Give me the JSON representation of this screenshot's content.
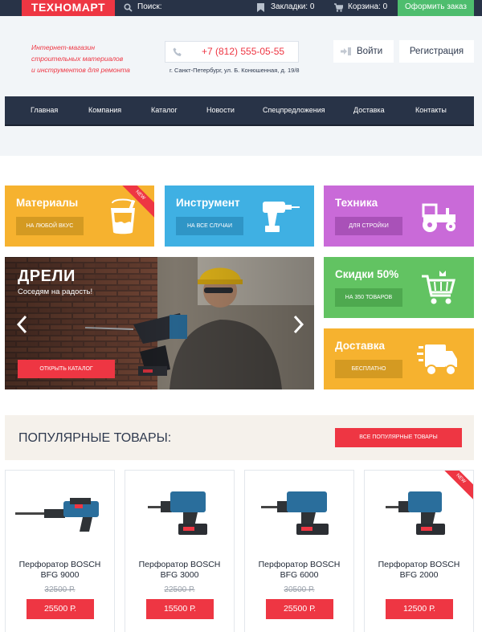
{
  "topbar": {
    "logo": "ТЕХНОМАРТ",
    "search_label": "Поиск:",
    "bookmarks_label": "Закладки: 0",
    "cart_label": "Корзина: 0",
    "checkout_label": "Оформить заказ"
  },
  "header": {
    "tagline": [
      "Интернет-магазин",
      "строительных материалов",
      "и инструментов для ремонта"
    ],
    "phone": "+7 (812) 555-05-55",
    "address": "г. Санкт-Петербург, ул. Б. Конюшенная, д. 19/8",
    "login_label": "Войти",
    "register_label": "Регистрация"
  },
  "nav": {
    "items": [
      "Главная",
      "Компания",
      "Каталог",
      "Новости",
      "Спецпредложения",
      "Доставка",
      "Контакты"
    ]
  },
  "tiles": {
    "materials": {
      "title": "Материалы",
      "button": "НА ЛЮБОЙ ВКУС",
      "ribbon": "NEW",
      "icon": "paint-bucket-icon",
      "color": "#f6b22f"
    },
    "tools": {
      "title": "Инструмент",
      "button": "НА ВСЕ СЛУЧАИ",
      "icon": "drill-icon",
      "color": "#3fb0e3"
    },
    "machinery": {
      "title": "Техника",
      "button": "ДЛЯ СТРОЙКИ",
      "icon": "tractor-icon",
      "color": "#c96ad8"
    },
    "discounts": {
      "title": "Скидки 50%",
      "button": "НА 350 ТОВАРОВ",
      "icon": "cart-icon",
      "color": "#62c362"
    },
    "delivery": {
      "title": "Доставка",
      "button": "БЕСПЛАТНО",
      "icon": "truck-icon",
      "color": "#f6b22f"
    }
  },
  "slider": {
    "title": "ДРЕЛИ",
    "subtitle": "Соседям на радость!",
    "button": "ОТКРЫТЬ КАТАЛОГ"
  },
  "popular": {
    "title": "ПОПУЛЯРНЫЕ ТОВАРЫ:",
    "button": "ВСЕ ПОПУЛЯРНЫЕ ТОВАРЫ"
  },
  "products": [
    {
      "name_line1": "Перфоратор BOSCH",
      "name_line2": "BFG 9000",
      "old_price": "32500 Р.",
      "price": "25500 Р."
    },
    {
      "name_line1": "Перфоратор BOSCH",
      "name_line2": "BFG 3000",
      "old_price": "22500 Р.",
      "price": "15500 Р."
    },
    {
      "name_line1": "Перфоратор BOSCH",
      "name_line2": "BFG 6000",
      "old_price": "30500 Р.",
      "price": "25500 Р."
    },
    {
      "name_line1": "Перфоратор BOSCH",
      "name_line2": "BFG 2000",
      "old_price": "",
      "price": "12500 Р.",
      "ribbon": "NEW"
    }
  ]
}
